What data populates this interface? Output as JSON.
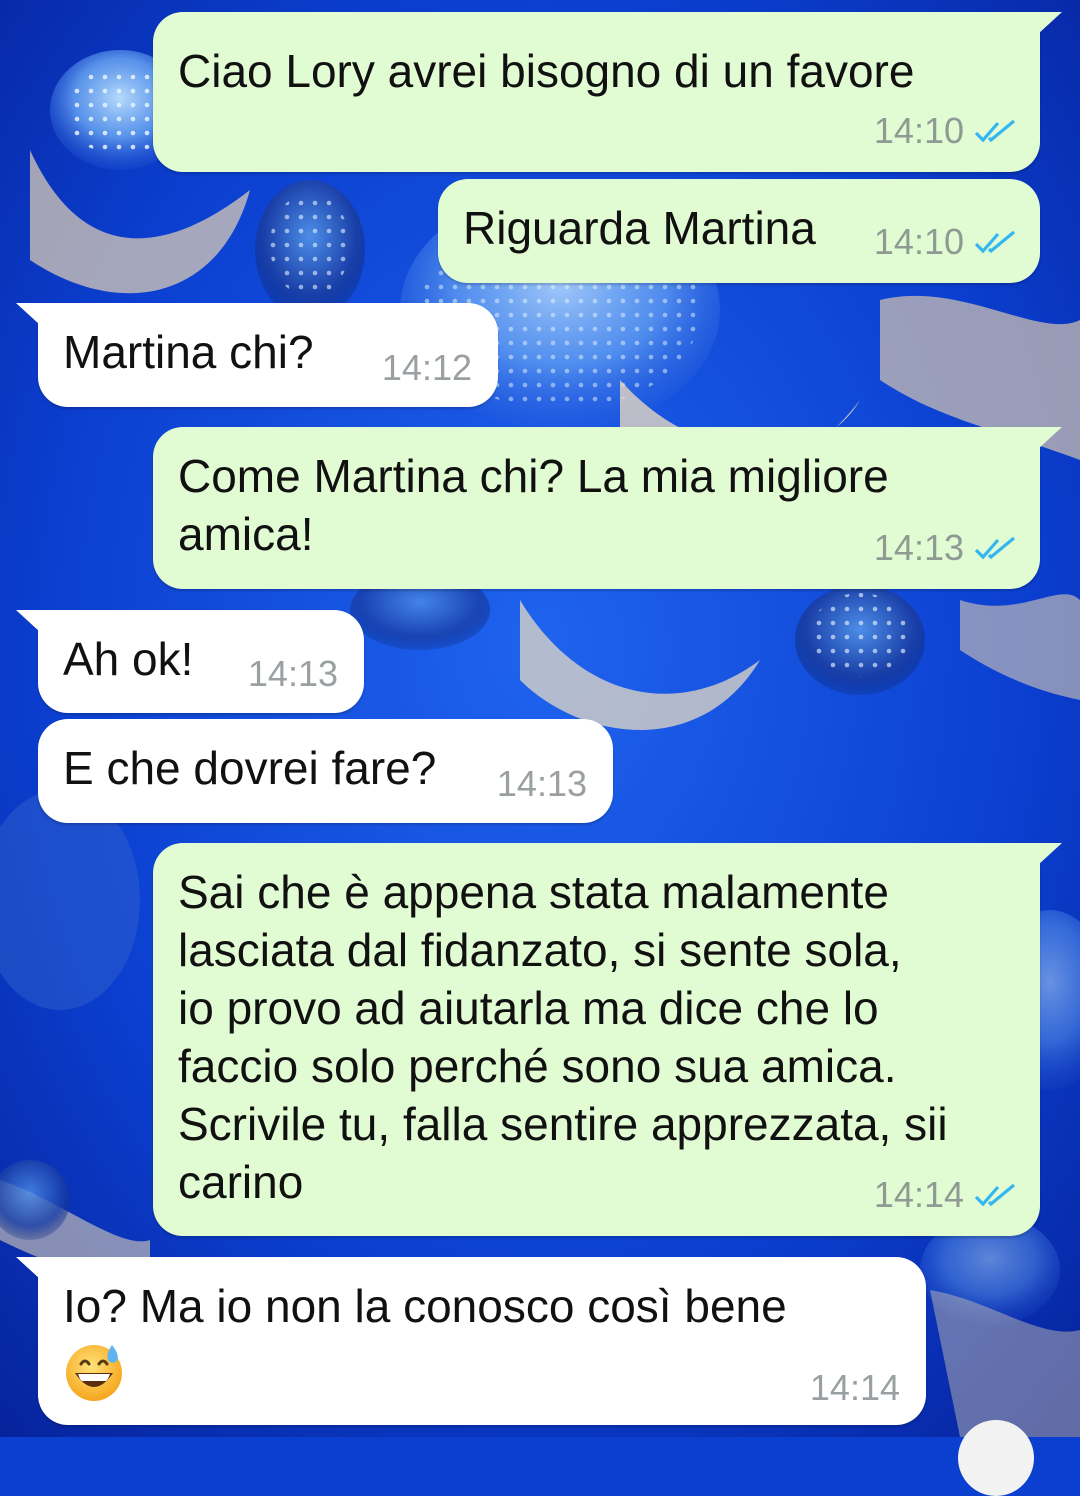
{
  "chat": {
    "messages": [
      {
        "direction": "out",
        "text": "Ciao Lory avrei bisogno di un favore",
        "time": "14:10",
        "read": true
      },
      {
        "direction": "out",
        "text": "Riguarda Martina",
        "time": "14:10",
        "read": true
      },
      {
        "direction": "in",
        "text": "Martina chi?",
        "time": "14:12"
      },
      {
        "direction": "out",
        "text": "Come Martina chi? La mia migliore\namica!",
        "time": "14:13",
        "read": true
      },
      {
        "direction": "in",
        "text": "Ah ok!",
        "time": "14:13"
      },
      {
        "direction": "in",
        "text": "E che dovrei fare?",
        "time": "14:13"
      },
      {
        "direction": "out",
        "text": "Sai che è appena stata malamente\nlasciata dal fidanzato, si sente sola,\nio provo ad aiutarla ma dice che lo\nfaccio solo perché sono sua amica.\nScrivile tu, falla sentire apprezzata, sii\ncarino",
        "time": "14:14",
        "read": true
      },
      {
        "direction": "in",
        "text": "Io? Ma io non la conosco così bene",
        "time": "14:14",
        "emoji": "grinning-face-with-sweat"
      }
    ]
  },
  "colors": {
    "outgoing_bubble": "#e1fbd3",
    "incoming_bubble": "#ffffff",
    "read_ticks": "#34b7f1",
    "wallpaper": "#0b3fd0"
  },
  "icons": {
    "read_receipt": "double-check-icon",
    "emoji": "grinning-face-with-sweat"
  }
}
